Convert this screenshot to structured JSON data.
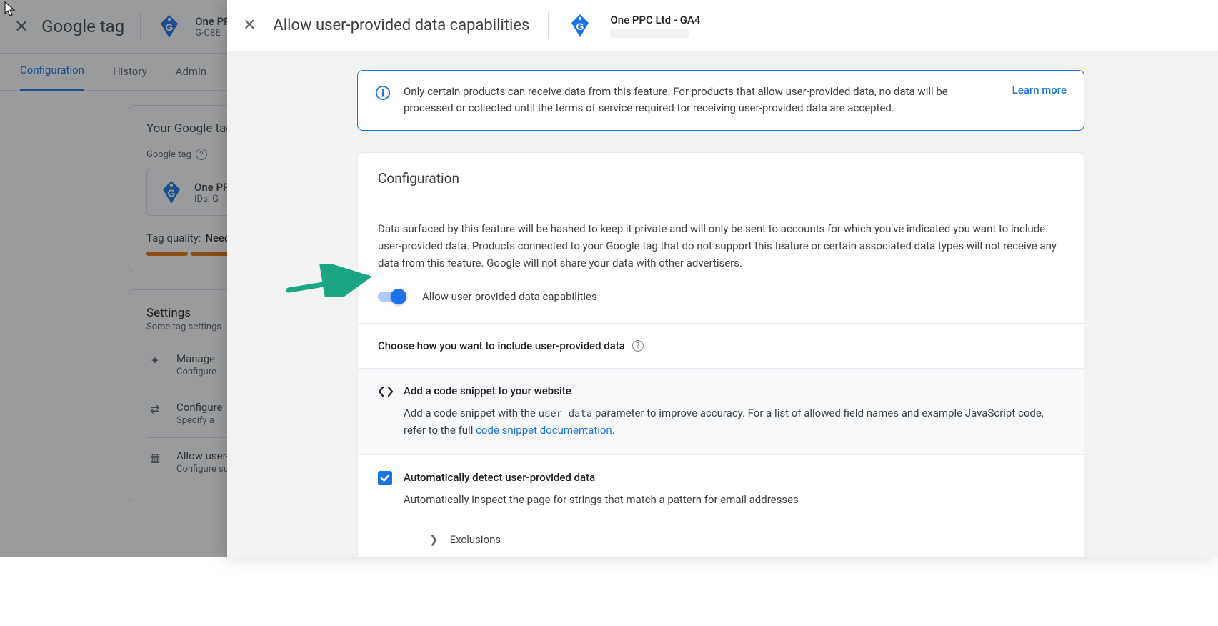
{
  "bg": {
    "title": "Google tag",
    "tag_name": "One PPC Ltd",
    "tag_id_label": "G-C8E",
    "tabs": [
      "Configuration",
      "History",
      "Admin"
    ],
    "card1_title": "Your Google tag",
    "card1_sub": "Google tag",
    "card1_tag_name": "One PPC Ltd",
    "card1_tag_ids": "IDs: G",
    "quality_label": "Tag quality:",
    "quality_value": "Needs attention",
    "settings_title": "Settings",
    "settings_sub": "Some tag settings",
    "settings_items": [
      {
        "title": "Manage",
        "desc": "Configure"
      },
      {
        "title": "Configure",
        "desc": "Specify a"
      },
      {
        "title": "Allow user-provided",
        "desc": "Configure such data"
      }
    ]
  },
  "panel": {
    "title": "Allow user-provided data capabilities",
    "tag_name": "One PPC Ltd - GA4",
    "banner_text": "Only certain products can receive data from this feature. For products that allow user-provided data, no data will be processed or collected until the terms of service required for receiving user-provided data are accepted.",
    "banner_link": "Learn more",
    "config_head": "Configuration",
    "config_desc": "Data surfaced by this feature will be hashed to keep it private and will only be sent to accounts for which you've indicated you want to include user-provided data. Products connected to your Google tag that do not support this feature or certain associated data types will not receive any data from this feature. Google will not share your data with other advertisers.",
    "toggle_label": "Allow user-provided data capabilities",
    "choose_label": "Choose how you want to include user-provided data",
    "opt1_title": "Add a code snippet to your website",
    "opt1_desc_pre": "Add a code snippet with the ",
    "opt1_desc_code": "user_data",
    "opt1_desc_post": " parameter to improve accuracy. For a list of allowed field names and example JavaScript code, refer to the full ",
    "opt1_link": "code snippet documentation",
    "opt2_title": "Automatically detect user-provided data",
    "opt2_desc": "Automatically inspect the page for strings that match a pattern for email addresses",
    "exclusions": "Exclusions"
  }
}
